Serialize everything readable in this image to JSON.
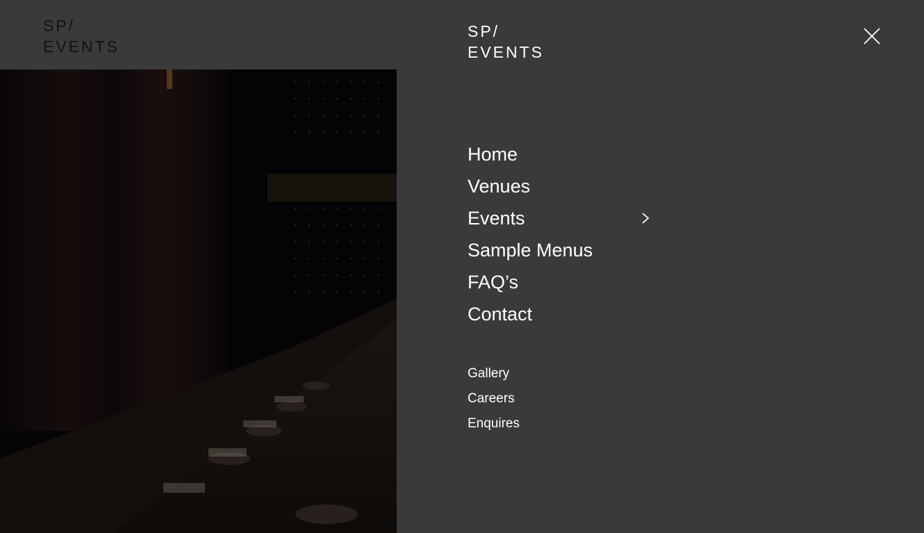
{
  "brand": {
    "logo_line1": "SP/",
    "logo_line2": "EVENTS"
  },
  "menu": {
    "close_icon": "close-icon",
    "primary": [
      {
        "label": "Home"
      },
      {
        "label": "Venues"
      },
      {
        "label": "Events",
        "has_submenu": true,
        "icon": "chevron-right-icon"
      },
      {
        "label": "Sample Menus"
      },
      {
        "label": "FAQ’s"
      },
      {
        "label": "Contact"
      }
    ],
    "secondary": [
      {
        "label": "Gallery"
      },
      {
        "label": "Careers"
      },
      {
        "label": "Enquires"
      }
    ]
  },
  "colors": {
    "overlay_background": "#3a3a3b",
    "menu_text": "#ffffff",
    "dimmed_logo": "#121212"
  }
}
